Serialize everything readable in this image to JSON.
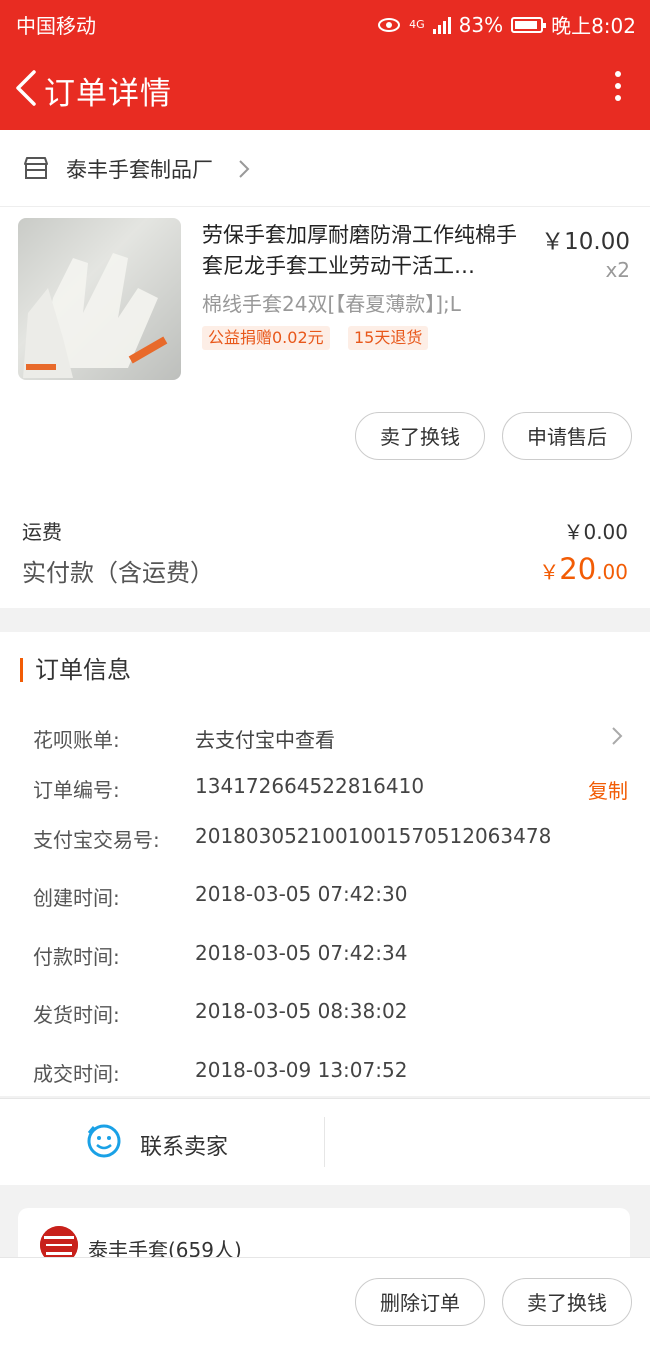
{
  "status": {
    "carrier": "中国移动",
    "battery": "83%",
    "network": "4G",
    "time": "晚上8:02"
  },
  "nav": {
    "title": "订单详情"
  },
  "shop": {
    "name": "泰丰手套制品厂",
    "product": {
      "title": "劳保手套加厚耐磨防滑工作纯棉手套尼龙手套工业劳动干活工…",
      "price": "￥10.00",
      "qty": "x2",
      "sku": "棉线手套24双[【春夏薄款】];L",
      "tags": [
        "公益捐赠0.02元",
        "15天退货"
      ]
    },
    "actions": [
      "卖了换钱",
      "申请售后"
    ],
    "fee_label": "运费",
    "fee_value": "￥0.00",
    "paid_label": "实付款（含运费）",
    "paid_symbol": "￥",
    "paid_int": "20",
    "paid_dec": ".00"
  },
  "order_info": {
    "title": "订单信息",
    "rows": [
      {
        "label": "花呗账单:",
        "value": "去支付宝中查看"
      },
      {
        "label": "订单编号:",
        "value": "134172664522816410"
      },
      {
        "label": "支付宝交易号:",
        "value": "2018030521001001570512063478"
      },
      {
        "label": "创建时间:",
        "value": "2018-03-05 07:42:30"
      },
      {
        "label": "付款时间:",
        "value": "2018-03-05 07:42:34"
      },
      {
        "label": "发货时间:",
        "value": "2018-03-05 08:38:02"
      },
      {
        "label": "成交时间:",
        "value": "2018-03-09 13:07:52"
      }
    ],
    "copy_label": "复制"
  },
  "contact": {
    "label": "联系卖家"
  },
  "group": {
    "name": "泰丰手套(659人)"
  },
  "bottom": {
    "actions": [
      "删除订单",
      "卖了换钱"
    ]
  },
  "colors": {
    "brand_red": "#e82c22",
    "accent_orange": "#f25c05"
  }
}
